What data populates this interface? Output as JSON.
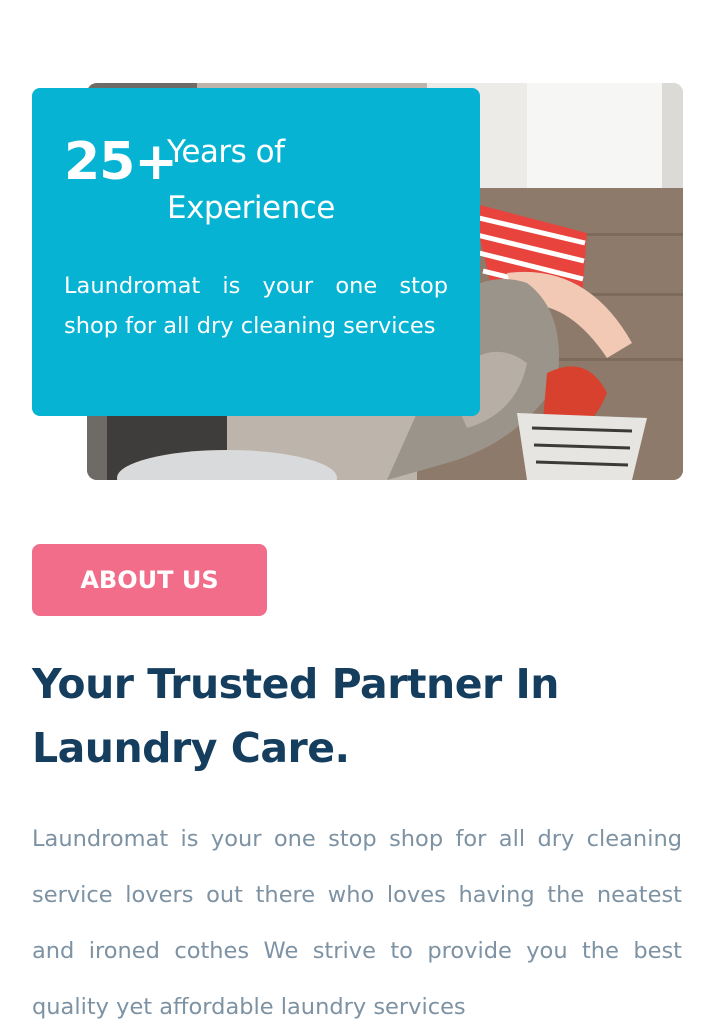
{
  "hero": {
    "image_alt": "Person loading laundry basket"
  },
  "experience": {
    "number": "25+",
    "label": "Years of Experience",
    "description": "Laundromat is your one stop shop for all dry cleaning services"
  },
  "about": {
    "button_label": "ABOUT US",
    "title": "Your Trusted Partner In Laundry Care.",
    "body": "Laundromat is your one stop shop for all dry cleaning service lovers out there who loves having the neatest and ironed cothes We strive to provide you the best quality yet affordable laundry services"
  },
  "colors": {
    "card_accent": "#07b3d3",
    "button_pink": "#f26d8a",
    "heading_navy": "#143d5e",
    "body_gray": "#7d92a3"
  }
}
